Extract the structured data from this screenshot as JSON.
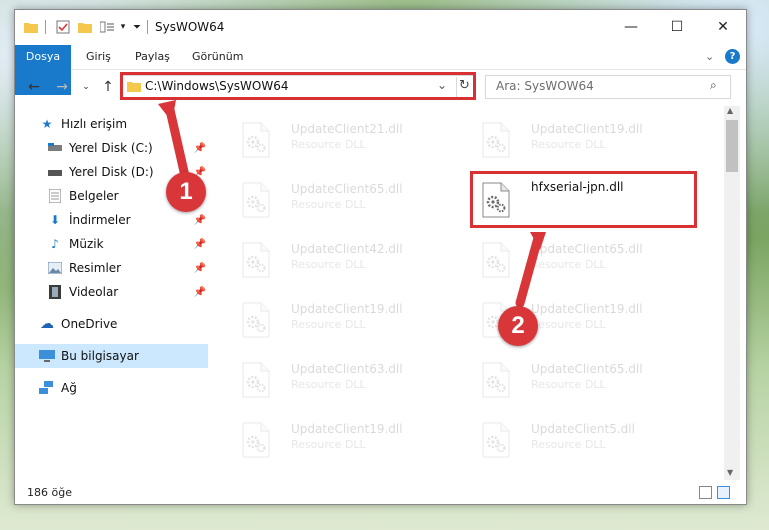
{
  "window": {
    "title": "SysWOW64",
    "minimize_glyph": "—",
    "maximize_glyph": "☐",
    "close_glyph": "✕"
  },
  "ribbon": {
    "tabs": [
      "Dosya",
      "Giriş",
      "Paylaş",
      "Görünüm"
    ],
    "expand_glyph": "⌄",
    "help_glyph": "?"
  },
  "address": {
    "path": "C:\\Windows\\SysWOW64",
    "search_placeholder": "Ara: SysWOW64"
  },
  "nav": {
    "items": [
      {
        "label": "Hızlı erişim",
        "icon": "star-icon"
      },
      {
        "label": "Yerel Disk (C:)",
        "icon": "drive-icon"
      },
      {
        "label": "Yerel Disk (D:)",
        "icon": "drive-icon"
      },
      {
        "label": "Belgeler",
        "icon": "documents-icon"
      },
      {
        "label": "İndirmeler",
        "icon": "download-icon"
      },
      {
        "label": "Müzik",
        "icon": "music-icon"
      },
      {
        "label": "Resimler",
        "icon": "pictures-icon"
      },
      {
        "label": "Videolar",
        "icon": "videos-icon"
      },
      {
        "label": "OneDrive",
        "icon": "cloud-icon"
      },
      {
        "label": "Bu bilgisayar",
        "icon": "computer-icon"
      },
      {
        "label": "Ağ",
        "icon": "network-icon"
      }
    ]
  },
  "files": {
    "left": [
      {
        "name": "UpdateClient21.dll",
        "desc": "Resource DLL"
      },
      {
        "name": "UpdateClient65.dll",
        "desc": "Resource DLL"
      },
      {
        "name": "UpdateClient42.dll",
        "desc": "Resource DLL"
      },
      {
        "name": "UpdateClient19.dll",
        "desc": "Resource DLL"
      },
      {
        "name": "UpdateClient63.dll",
        "desc": "Resource DLL"
      },
      {
        "name": "UpdateClient19.dll",
        "desc": "Resource DLL"
      }
    ],
    "right": [
      {
        "name": "UpdateClient19.dll",
        "desc": "Resource DLL"
      },
      {
        "name": "hfxserial-jpn.dll",
        "desc": ""
      },
      {
        "name": "UpdateClient65.dll",
        "desc": "Resource DLL"
      },
      {
        "name": "UpdateClient19.dll",
        "desc": "Resource DLL"
      },
      {
        "name": "UpdateClient65.dll",
        "desc": "Resource DLL"
      },
      {
        "name": "UpdateClient5.dll",
        "desc": "Resource DLL"
      }
    ]
  },
  "status": {
    "count": "186 öğe"
  },
  "callouts": {
    "one": "1",
    "two": "2"
  },
  "colors": {
    "accent": "#1979ca",
    "highlight": "#d93034",
    "selected_nav": "#cce8ff"
  }
}
